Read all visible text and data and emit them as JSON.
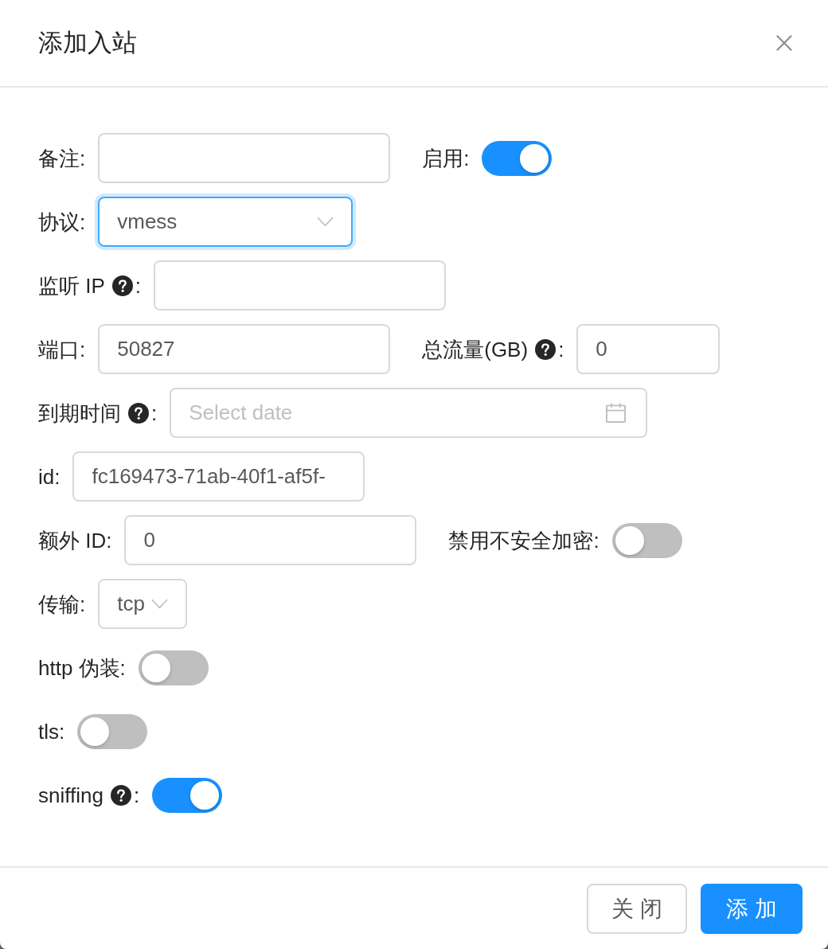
{
  "dialog": {
    "title": "添加入站"
  },
  "rows": [
    [
      {
        "kind": "input",
        "label": "备注",
        "colon": ":",
        "help": false
      },
      {
        "kind": "switch",
        "label": "启用",
        "colon": ":",
        "help": false,
        "on": true
      }
    ],
    [
      {
        "kind": "select",
        "label": "协议",
        "colon": ":",
        "help": false,
        "value": "vmess",
        "focused": true
      }
    ],
    [
      {
        "kind": "input",
        "label": "监听 IP",
        "colon": ":",
        "help": true
      }
    ],
    [
      {
        "kind": "input",
        "label": "端口",
        "colon": ":",
        "help": false,
        "value": "50827"
      },
      {
        "kind": "input",
        "label": "总流量(GB)",
        "colon": ":",
        "help": true,
        "value": "0"
      }
    ],
    [
      {
        "kind": "date",
        "label": "到期时间",
        "colon": ":",
        "help": true,
        "placeholder": "Select date"
      }
    ],
    [
      {
        "kind": "input",
        "label": "id",
        "colon": ":",
        "help": false,
        "value": "fc169473-71ab-40f1-af5f-"
      }
    ],
    [
      {
        "kind": "input",
        "label": "额外 ID",
        "colon": ":",
        "help": false,
        "value": "0"
      },
      {
        "kind": "switch",
        "label": "禁用不安全加密",
        "colon": ":",
        "help": false,
        "on": false
      }
    ],
    [
      {
        "kind": "select",
        "label": "传输",
        "colon": ":",
        "help": false,
        "value": "tcp",
        "focused": false
      }
    ],
    [
      {
        "kind": "switch",
        "label": "http 伪装",
        "colon": ":",
        "help": false,
        "on": false
      }
    ],
    [
      {
        "kind": "switch",
        "label": "tls",
        "colon": ":",
        "help": false,
        "on": false
      }
    ],
    [
      {
        "kind": "switch",
        "label": "sniffing",
        "colon": ":",
        "help": true,
        "on": true
      }
    ]
  ],
  "buttons": [
    {
      "label": "关 闭",
      "kind": "default"
    },
    {
      "label": "添 加",
      "kind": "primary"
    }
  ]
}
